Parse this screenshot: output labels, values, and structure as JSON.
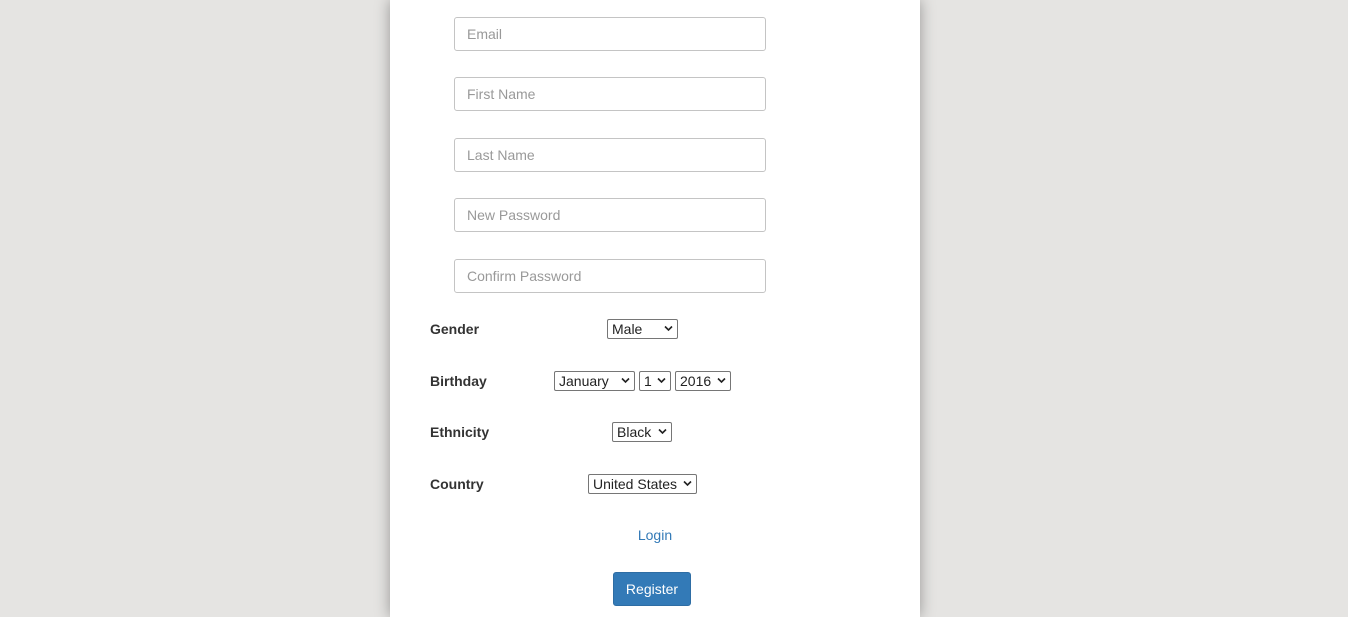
{
  "form": {
    "fields": {
      "email": {
        "placeholder": "Email",
        "value": ""
      },
      "first_name": {
        "placeholder": "First Name",
        "value": ""
      },
      "last_name": {
        "placeholder": "Last Name",
        "value": ""
      },
      "new_password": {
        "placeholder": "New Password",
        "value": ""
      },
      "confirm_password": {
        "placeholder": "Confirm Password",
        "value": ""
      }
    },
    "gender": {
      "label": "Gender",
      "selected": "Male"
    },
    "birthday": {
      "label": "Birthday",
      "month": "January",
      "day": "1",
      "year": "2016"
    },
    "ethnicity": {
      "label": "Ethnicity",
      "selected": "Black"
    },
    "country": {
      "label": "Country",
      "selected": "United States"
    },
    "login_link": "Login",
    "register_button": "Register"
  },
  "colors": {
    "page_background": "#e5e4e2",
    "card_background": "#ffffff",
    "link": "#337ab7",
    "primary_button": "#337ab7"
  }
}
